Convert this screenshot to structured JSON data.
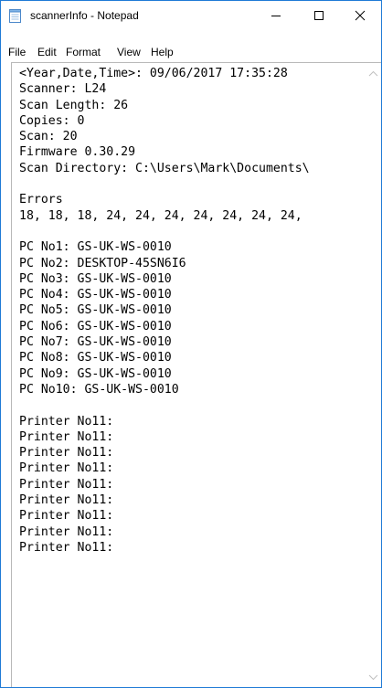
{
  "window": {
    "title": "scannerInfo - Notepad",
    "icon": "notepad-icon",
    "controls": {
      "minimize": "minimize-icon",
      "maximize": "maximize-icon",
      "close": "close-icon"
    }
  },
  "menu": {
    "items": [
      "File",
      "Edit",
      "Format",
      "View",
      "Help"
    ]
  },
  "editor": {
    "lines": [
      "<Year,Date,Time>: 09/06/2017 17:35:28",
      "Scanner: L24",
      "Scan Length: 26",
      "Copies: 0",
      "Scan: 20",
      "Firmware 0.30.29",
      "Scan Directory: C:\\Users\\Mark\\Documents\\",
      "",
      "Errors",
      "18, 18, 18, 24, 24, 24, 24, 24, 24, 24,",
      "",
      "PC No1: GS-UK-WS-0010",
      "PC No2: DESKTOP-45SN6I6",
      "PC No3: GS-UK-WS-0010",
      "PC No4: GS-UK-WS-0010",
      "PC No5: GS-UK-WS-0010",
      "PC No6: GS-UK-WS-0010",
      "PC No7: GS-UK-WS-0010",
      "PC No8: GS-UK-WS-0010",
      "PC No9: GS-UK-WS-0010",
      "PC No10: GS-UK-WS-0010",
      "",
      "Printer No11:",
      "Printer No11:",
      "Printer No11:",
      "Printer No11:",
      "Printer No11:",
      "Printer No11:",
      "Printer No11:",
      "Printer No11:",
      "Printer No11:"
    ]
  },
  "scrollbar": {
    "up": "chevron-up-icon",
    "down": "chevron-down-icon"
  }
}
